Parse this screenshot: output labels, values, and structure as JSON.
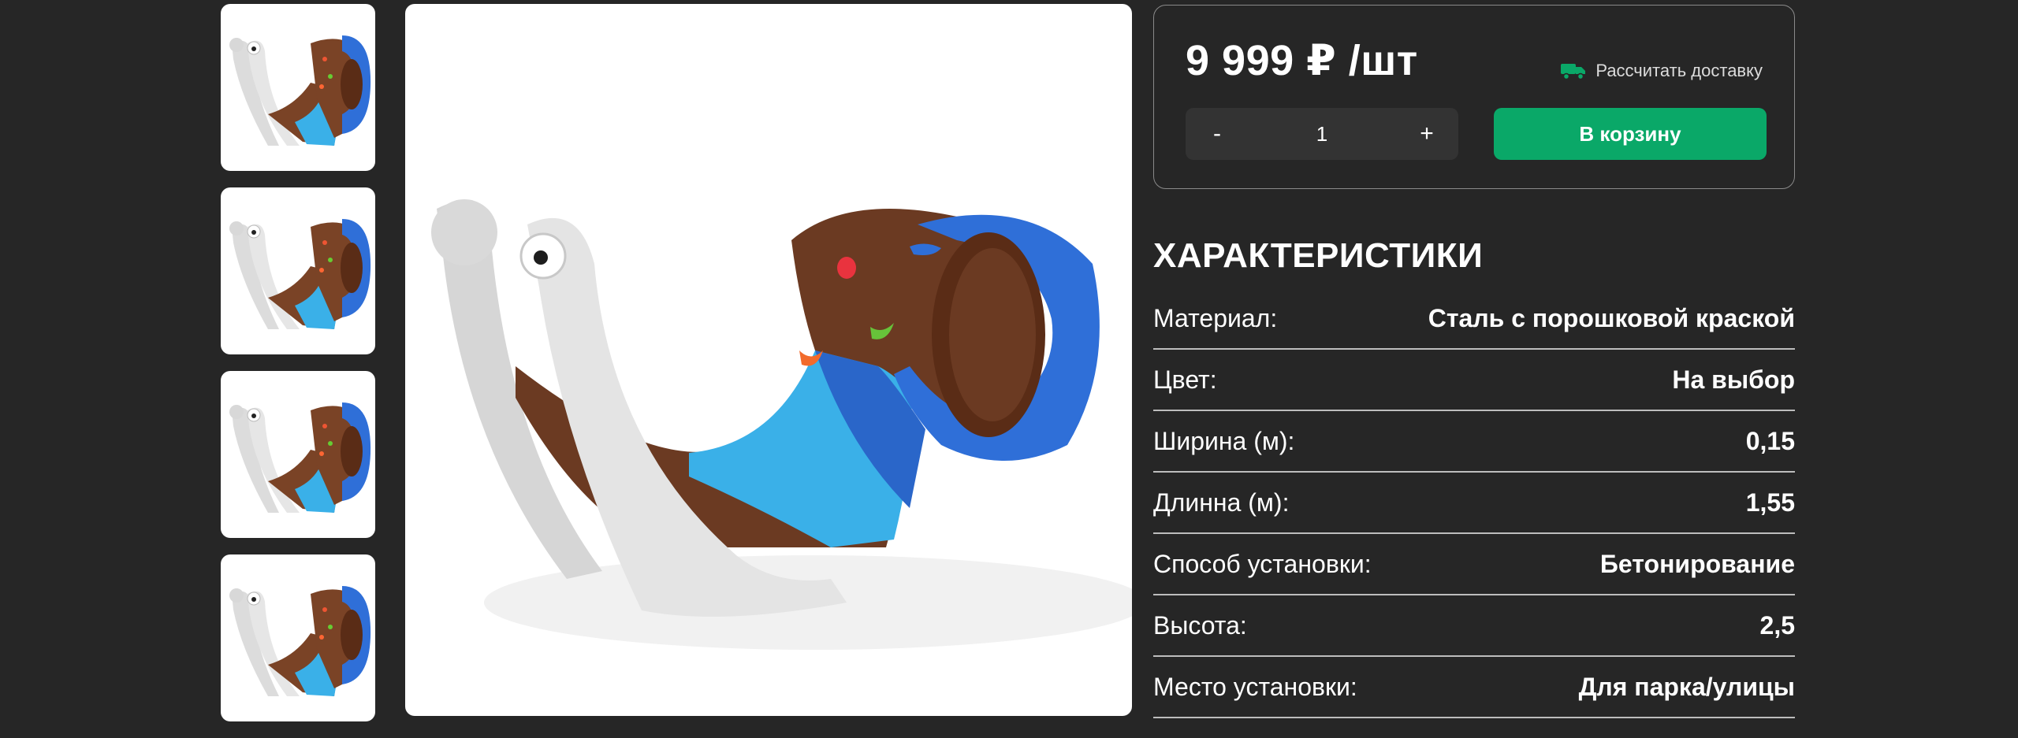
{
  "product": {
    "price": "9 999 ₽ /шт",
    "delivery_label": "Рассчитать доставку",
    "quantity": "1",
    "decrement_label": "-",
    "increment_label": "+",
    "add_to_cart_label": "В корзину"
  },
  "specs": {
    "title": "ХАРАКТЕРИСТИКИ",
    "rows": [
      {
        "label": "Материал:",
        "value": "Сталь с порошковой краской"
      },
      {
        "label": "Цвет:",
        "value": "На выбор"
      },
      {
        "label": "Ширина (м):",
        "value": "0,15"
      },
      {
        "label": "Длинна (м):",
        "value": "1,55"
      },
      {
        "label": "Способ установки:",
        "value": "Бетонирование"
      },
      {
        "label": "Высота:",
        "value": "2,5"
      },
      {
        "label": "Место установки:",
        "value": "Для парка/улицы"
      }
    ]
  },
  "colors": {
    "background": "#262626",
    "accent_green": "#0aa868",
    "snail_blue": "#2f6fd8",
    "slide_light_blue": "#3ab0e8",
    "wood_brown": "#6b3a22"
  },
  "gallery": {
    "thumbnail_count": 4
  }
}
